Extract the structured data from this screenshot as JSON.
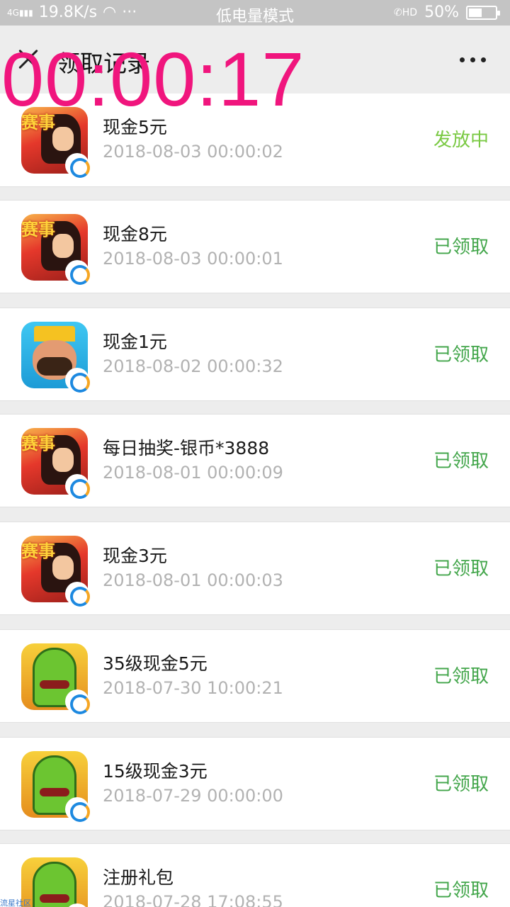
{
  "status_bar": {
    "network": "4G",
    "speed": "19.8K/s",
    "more": "···",
    "mode": "低电量模式",
    "hd": "HD",
    "battery": "50%",
    "battery_level": 0.5
  },
  "nav": {
    "title": "领取记录",
    "more_label": "···"
  },
  "timer": "00:00:17",
  "colors": {
    "claimed": "#43a64b",
    "issuing": "#7ac943",
    "timer": "#f0157d"
  },
  "records": [
    {
      "icon": "fighter-game-icon",
      "title": "现金5元",
      "date": "2018-08-03 00:00:02",
      "status": "发放中",
      "status_color": "#7ac943"
    },
    {
      "icon": "fighter-game-icon",
      "title": "现金8元",
      "date": "2018-08-03 00:00:01",
      "status": "已领取",
      "status_color": "#43a64b"
    },
    {
      "icon": "royale-game-icon",
      "title": "现金1元",
      "date": "2018-08-02 00:00:32",
      "status": "已领取",
      "status_color": "#43a64b"
    },
    {
      "icon": "fighter-game-icon",
      "title": "每日抽奖-银币*3888",
      "date": "2018-08-01 00:00:09",
      "status": "已领取",
      "status_color": "#43a64b"
    },
    {
      "icon": "fighter-game-icon",
      "title": "现金3元",
      "date": "2018-08-01 00:00:03",
      "status": "已领取",
      "status_color": "#43a64b"
    },
    {
      "icon": "cactus-game-icon",
      "title": "35级现金5元",
      "date": "2018-07-30 10:00:21",
      "status": "已领取",
      "status_color": "#43a64b"
    },
    {
      "icon": "cactus-game-icon",
      "title": "15级现金3元",
      "date": "2018-07-29 00:00:00",
      "status": "已领取",
      "status_color": "#43a64b"
    },
    {
      "icon": "cactus-game-icon",
      "title": "注册礼包",
      "date": "2018-07-28 17:08:55",
      "status": "已领取",
      "status_color": "#43a64b"
    }
  ],
  "watermark": "流星社区"
}
